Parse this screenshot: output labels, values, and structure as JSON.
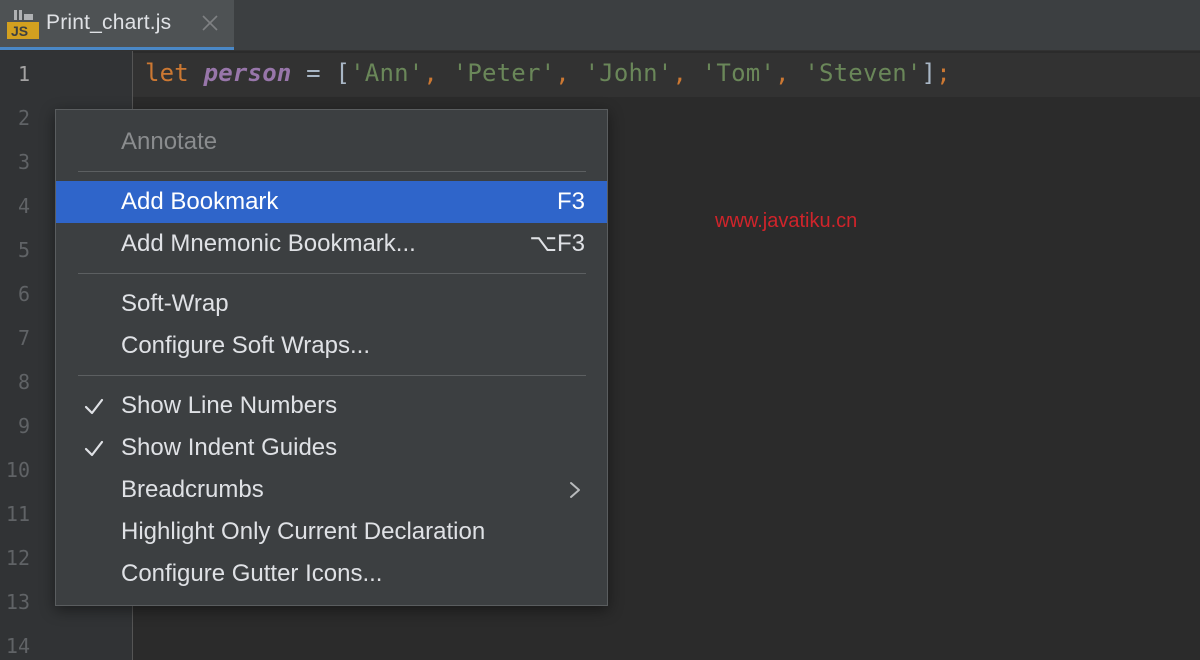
{
  "tab": {
    "icon": "javascript-file-icon",
    "icon_text": "JS",
    "title": "Print_chart.js",
    "close_icon": "close-icon"
  },
  "gutter": {
    "line_numbers": [
      "1",
      "2",
      "3",
      "4",
      "5",
      "6",
      "7",
      "8",
      "9",
      "10",
      "11",
      "12",
      "13",
      "14"
    ],
    "current_line": "1"
  },
  "editor": {
    "line1": {
      "keyword": "let",
      "variable": "person",
      "operator": "=",
      "open_bracket": "[",
      "strings": [
        "'Ann'",
        "'Peter'",
        "'John'",
        "'Tom'",
        "'Steven'"
      ],
      "separator": ",",
      "close_bracket": "]",
      "semicolon": ";"
    }
  },
  "watermark": "www.javatiku.cn",
  "context_menu": {
    "items": [
      {
        "label": "Annotate",
        "disabled": true
      },
      {
        "label": "Add Bookmark",
        "shortcut": "F3",
        "selected": true
      },
      {
        "label": "Add Mnemonic Bookmark...",
        "shortcut": "⌥F3"
      },
      {
        "label": "Soft-Wrap"
      },
      {
        "label": "Configure Soft Wraps..."
      },
      {
        "label": "Show Line Numbers",
        "checked": true
      },
      {
        "label": "Show Indent Guides",
        "checked": true
      },
      {
        "label": "Breadcrumbs",
        "submenu": true
      },
      {
        "label": "Highlight Only Current Declaration"
      },
      {
        "label": "Configure Gutter Icons..."
      }
    ]
  },
  "colors": {
    "selection": "#2f65ca",
    "keyword": "#cc7832",
    "variable": "#9876aa",
    "string": "#6a8759",
    "watermark": "#d0242b"
  }
}
